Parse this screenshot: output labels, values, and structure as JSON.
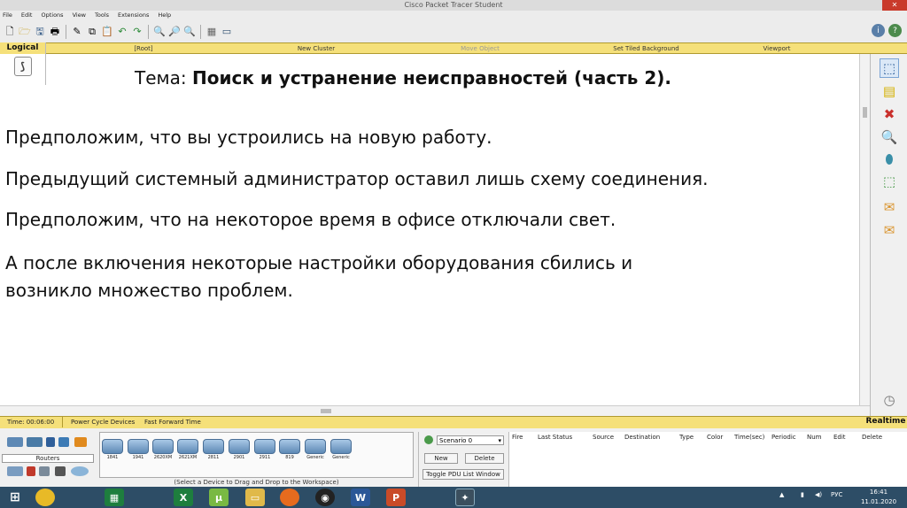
{
  "window": {
    "title": "Cisco Packet Tracer Student",
    "close_glyph": "✕"
  },
  "menu": [
    "File",
    "Edit",
    "Options",
    "View",
    "Tools",
    "Extensions",
    "Help"
  ],
  "toolbar_icons": [
    "new-file-icon",
    "open-folder-icon",
    "save-icon",
    "print-icon",
    "activity-wizard-icon",
    "copy-icon",
    "paste-icon",
    "undo-icon",
    "redo-icon",
    "zoom-in-icon",
    "zoom-reset-icon",
    "zoom-out-icon",
    "drawing-palette-icon",
    "custom-device-icon"
  ],
  "help_icons": {
    "info": "i",
    "help": "?"
  },
  "navbar": {
    "logical": "Logical",
    "root": "[Root]",
    "new_cluster": "New Cluster",
    "move_object": "Move Object",
    "set_tiled_background": "Set Tiled Background",
    "viewport": "Viewport"
  },
  "slide": {
    "title_prefix": "Тема: ",
    "title_bold": "Поиск и устранение неисправностей (часть 2).",
    "lines": [
      "Предположим, что вы устроились на новую работу.",
      "Предыдущий системный администратор оставил лишь схему соединения.",
      "Предположим, что на некоторое время в офисе отключали свет.",
      "А после включения некоторые настройки оборудования сбились и",
      "возникло множество проблем."
    ]
  },
  "right_tools": [
    "select-icon",
    "note-icon",
    "delete-icon",
    "inspect-icon",
    "draw-shape-icon",
    "resize-icon",
    "add-simple-pdu-icon",
    "add-complex-pdu-icon"
  ],
  "status": {
    "time": "Time: 00:06:00",
    "power_cycle": "Power Cycle Devices",
    "fast_forward": "Fast Forward Time",
    "realtime": "Realtime"
  },
  "device_category_label": "Routers",
  "devices": [
    "1841",
    "1941",
    "2620XM",
    "2621XM",
    "2811",
    "2901",
    "2911",
    "819",
    "Generic",
    "Generic"
  ],
  "device_hint": "(Select a Device to Drag and Drop to the Workspace)",
  "scenario": {
    "selected": "Scenario 0",
    "new": "New",
    "delete": "Delete",
    "toggle": "Toggle PDU List Window"
  },
  "pdu_columns": [
    "Fire",
    "Last Status",
    "Source",
    "Destination",
    "Type",
    "Color",
    "Time(sec)",
    "Periodic",
    "Num",
    "Edit",
    "Delete"
  ],
  "taskbar": {
    "apps": [
      "windows-start-icon",
      "chrome-icon",
      "excel-like-icon",
      "excel-icon",
      "utorrent-icon",
      "explorer-icon",
      "firefox-icon",
      "media-icon",
      "word-icon",
      "powerpoint-icon",
      "packet-tracer-icon"
    ],
    "lang": "РУС",
    "time": "16:41",
    "date": "11.01.2020"
  },
  "colors": {
    "nav": "#f5e07a",
    "taskbar": "#2d4d66",
    "close": "#c93a2b"
  }
}
